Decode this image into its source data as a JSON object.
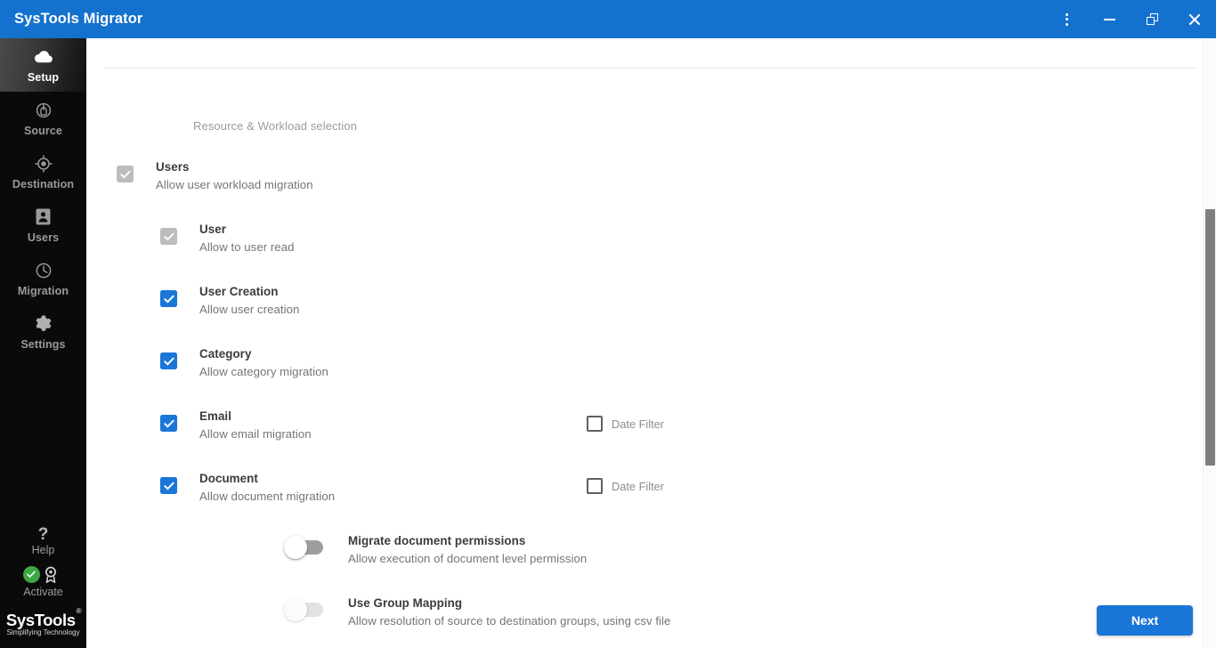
{
  "window": {
    "title": "SysTools Migrator",
    "accent_color": "#1472ce",
    "controls": [
      {
        "name": "menu",
        "icon": "kebab-menu-icon"
      },
      {
        "name": "minimize",
        "icon": "minimize-icon"
      },
      {
        "name": "restore",
        "icon": "restore-icon"
      },
      {
        "name": "close",
        "icon": "close-icon"
      }
    ]
  },
  "sidebar": {
    "items": [
      {
        "label": "Setup",
        "icon": "cloud-icon",
        "active": true
      },
      {
        "label": "Source",
        "icon": "source-icon",
        "active": false
      },
      {
        "label": "Destination",
        "icon": "target-icon",
        "active": false
      },
      {
        "label": "Users",
        "icon": "user-card-icon",
        "active": false
      },
      {
        "label": "Migration",
        "icon": "clock-icon",
        "active": false
      },
      {
        "label": "Settings",
        "icon": "gear-icon",
        "active": false
      }
    ],
    "help": {
      "label": "Help",
      "icon": "question-mark-icon"
    },
    "activate": {
      "label": "Activate",
      "icon": "award-badge-icon",
      "status_icon": "green-check-icon",
      "status_color": "#3ea845"
    },
    "logo": {
      "name": "SysTools",
      "registered": "®",
      "tagline": "Simplifying Technology"
    }
  },
  "main": {
    "section_caption": "Resource & Workload selection",
    "checkbox_blue": "#1a76d8",
    "checkbox_gray": "#bdbdbd",
    "rows": [
      {
        "title": "Users",
        "desc": "Allow user workload migration",
        "level": 0,
        "state": "checked-disabled",
        "date_filter": null
      },
      {
        "title": "User",
        "desc": "Allow to user read",
        "level": 1,
        "state": "checked-disabled",
        "date_filter": null
      },
      {
        "title": "User Creation",
        "desc": "Allow user creation",
        "level": 1,
        "state": "checked",
        "date_filter": null
      },
      {
        "title": "Category",
        "desc": "Allow category migration",
        "level": 1,
        "state": "checked",
        "date_filter": null
      },
      {
        "title": "Email",
        "desc": "Allow email migration",
        "level": 1,
        "state": "checked",
        "date_filter": {
          "label": "Date Filter",
          "state": "unchecked"
        }
      },
      {
        "title": "Document",
        "desc": "Allow document migration",
        "level": 1,
        "state": "checked",
        "date_filter": {
          "label": "Date Filter",
          "state": "unchecked"
        }
      }
    ],
    "toggles": [
      {
        "title": "Migrate document permissions",
        "desc": "Allow execution of document level permission",
        "state": "off"
      },
      {
        "title": "Use Group Mapping",
        "desc": "Allow resolution of source to destination groups, using csv file",
        "state": "off-disabled"
      }
    ]
  },
  "footer": {
    "next_label": "Next"
  }
}
